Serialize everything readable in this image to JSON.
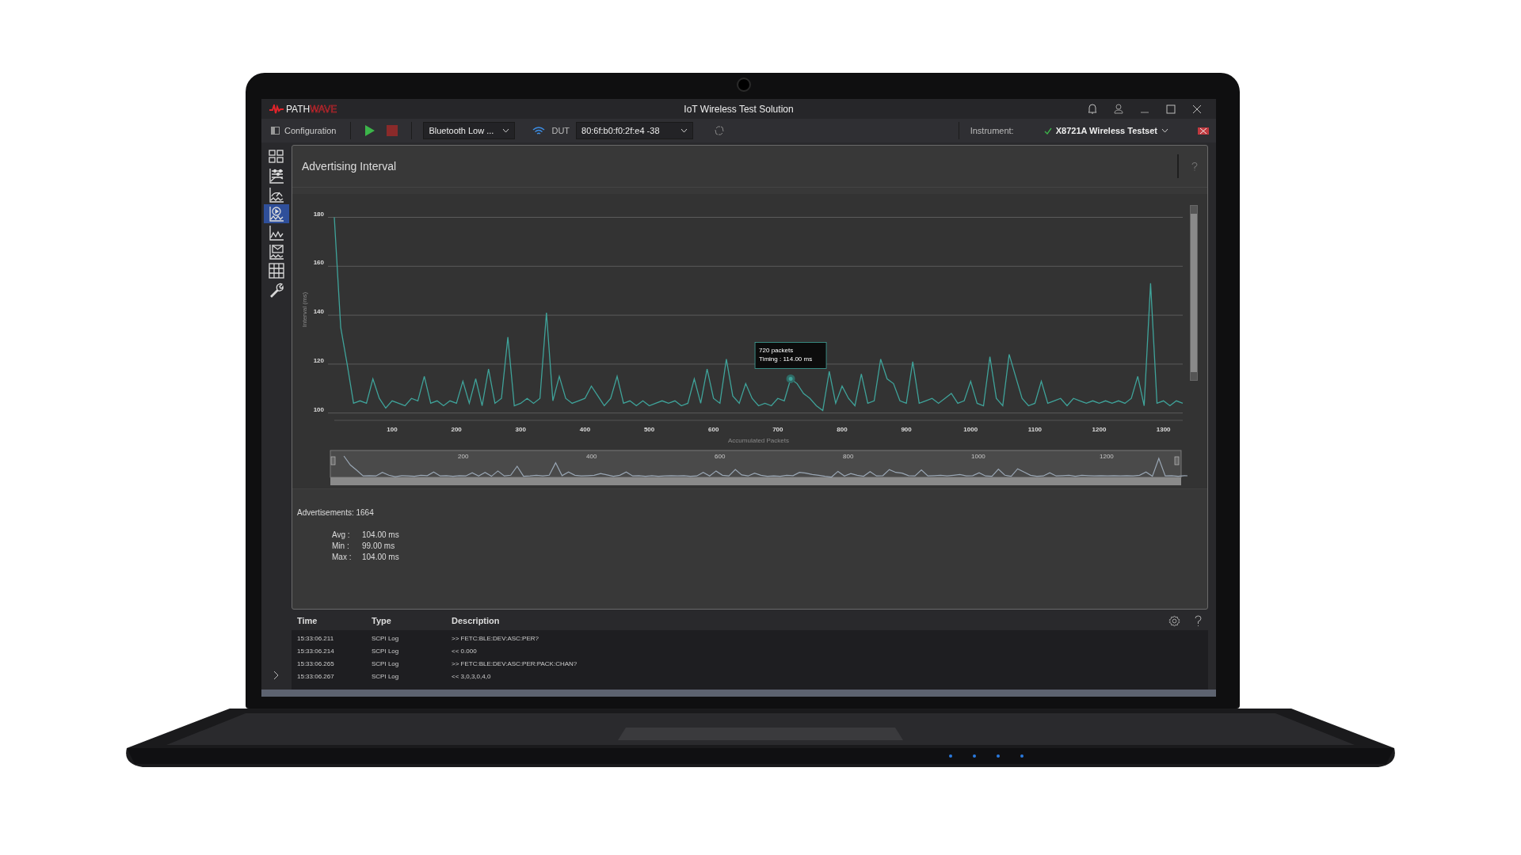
{
  "window": {
    "brand": {
      "text": "PATH",
      "accent": "WAVE"
    },
    "title": "IoT Wireless Test Solution"
  },
  "toolbar": {
    "configuration": "Configuration",
    "technology": "Bluetooth Low ...",
    "dut_label": "DUT",
    "dut": "80:6f:b0:f0:2f:e4 -38",
    "instrument_label": "Instrument:",
    "instrument": "X8721A Wireless Testset"
  },
  "sidebar": {
    "items": [
      {
        "kind": "dashboard",
        "selected": false
      },
      {
        "kind": "sliders",
        "selected": false
      },
      {
        "kind": "gauge",
        "selected": false
      },
      {
        "kind": "timer",
        "selected": true
      },
      {
        "kind": "line",
        "selected": false
      },
      {
        "kind": "envelope",
        "selected": false
      },
      {
        "kind": "table",
        "selected": false
      },
      {
        "kind": "wrench",
        "selected": false
      }
    ]
  },
  "panel": {
    "title": "Advertising Interval",
    "chart_data": {
      "type": "line",
      "xlabel": "Accumulated Packets",
      "ylabel": "Interval (ms)",
      "xlim": [
        10,
        1330
      ],
      "ylim": [
        97,
        180
      ],
      "grid": true,
      "xticks": [
        100,
        200,
        300,
        400,
        500,
        600,
        700,
        800,
        900,
        1000,
        1100,
        1200,
        1300
      ],
      "yticks": [
        100,
        120,
        140,
        160,
        180
      ],
      "x": [
        10,
        20,
        30,
        40,
        50,
        60,
        70,
        80,
        90,
        100,
        110,
        120,
        130,
        140,
        150,
        160,
        170,
        180,
        190,
        200,
        210,
        220,
        230,
        240,
        250,
        260,
        270,
        280,
        290,
        300,
        310,
        320,
        330,
        340,
        350,
        360,
        370,
        380,
        390,
        400,
        410,
        420,
        430,
        440,
        450,
        460,
        470,
        480,
        490,
        500,
        510,
        520,
        530,
        540,
        550,
        560,
        570,
        580,
        590,
        600,
        610,
        620,
        630,
        640,
        650,
        660,
        670,
        680,
        690,
        700,
        710,
        720,
        730,
        740,
        750,
        760,
        770,
        780,
        790,
        800,
        810,
        820,
        830,
        840,
        850,
        860,
        870,
        880,
        890,
        900,
        910,
        920,
        930,
        940,
        950,
        960,
        970,
        980,
        990,
        1000,
        1010,
        1020,
        1030,
        1040,
        1050,
        1060,
        1070,
        1080,
        1090,
        1100,
        1110,
        1120,
        1130,
        1140,
        1150,
        1160,
        1170,
        1180,
        1190,
        1200,
        1210,
        1220,
        1230,
        1240,
        1250,
        1260,
        1270,
        1280,
        1290,
        1300,
        1310,
        1320,
        1330
      ],
      "series": [
        {
          "color": "#3fa39a",
          "values": [
            180,
            135,
            120,
            104,
            105,
            104,
            114,
            106,
            102,
            105,
            104,
            103,
            106,
            105,
            115,
            104,
            105,
            103,
            105,
            104,
            113,
            104,
            114,
            103,
            118,
            104,
            106,
            131,
            103,
            104,
            106,
            104,
            106,
            141,
            105,
            115,
            106,
            104,
            105,
            106,
            111,
            107,
            103,
            106,
            115,
            104,
            105,
            103,
            105,
            103,
            104,
            105,
            104,
            105,
            103,
            104,
            114,
            104,
            118,
            106,
            104,
            122,
            107,
            104,
            112,
            106,
            103,
            104,
            103,
            106,
            105,
            114,
            112,
            108,
            106,
            103,
            101,
            117,
            104,
            111,
            106,
            103,
            116,
            104,
            105,
            122,
            114,
            112,
            105,
            104,
            121,
            104,
            105,
            106,
            104,
            106,
            108,
            104,
            105,
            113,
            104,
            103,
            123,
            106,
            103,
            124,
            115,
            106,
            103,
            104,
            113,
            104,
            105,
            106,
            103,
            106,
            105,
            104,
            105,
            104,
            105,
            104,
            105,
            104,
            106,
            115,
            103,
            153,
            104,
            105,
            103,
            105,
            104
          ]
        }
      ],
      "annotations": [
        {
          "text": "720 packets\nTiming : 114.00 ms"
        }
      ]
    },
    "navigator": {
      "labels": [
        "200",
        "400",
        "600",
        "800",
        "1000",
        "1200"
      ]
    },
    "advertisements": "Advertisements: 1664",
    "stats": [
      {
        "label": "Avg :",
        "value": "104.00 ms"
      },
      {
        "label": "Min :",
        "value": "99.00 ms"
      },
      {
        "label": "Max :",
        "value": "104.00 ms"
      }
    ]
  },
  "log": {
    "columns": [
      "Time",
      "Type",
      "Description"
    ],
    "rows": [
      [
        "15:33:06.211",
        "SCPI Log",
        ">> FETC:BLE:DEV:ASC:PER?"
      ],
      [
        "15:33:06.214",
        "SCPI Log",
        "<< 0.000"
      ],
      [
        "15:33:06.265",
        "SCPI Log",
        ">> FETC:BLE:DEV:ASC:PER:PACK:CHAN?"
      ],
      [
        "15:33:06.267",
        "SCPI Log",
        "<< 3,0,3,0,4,0"
      ]
    ]
  }
}
